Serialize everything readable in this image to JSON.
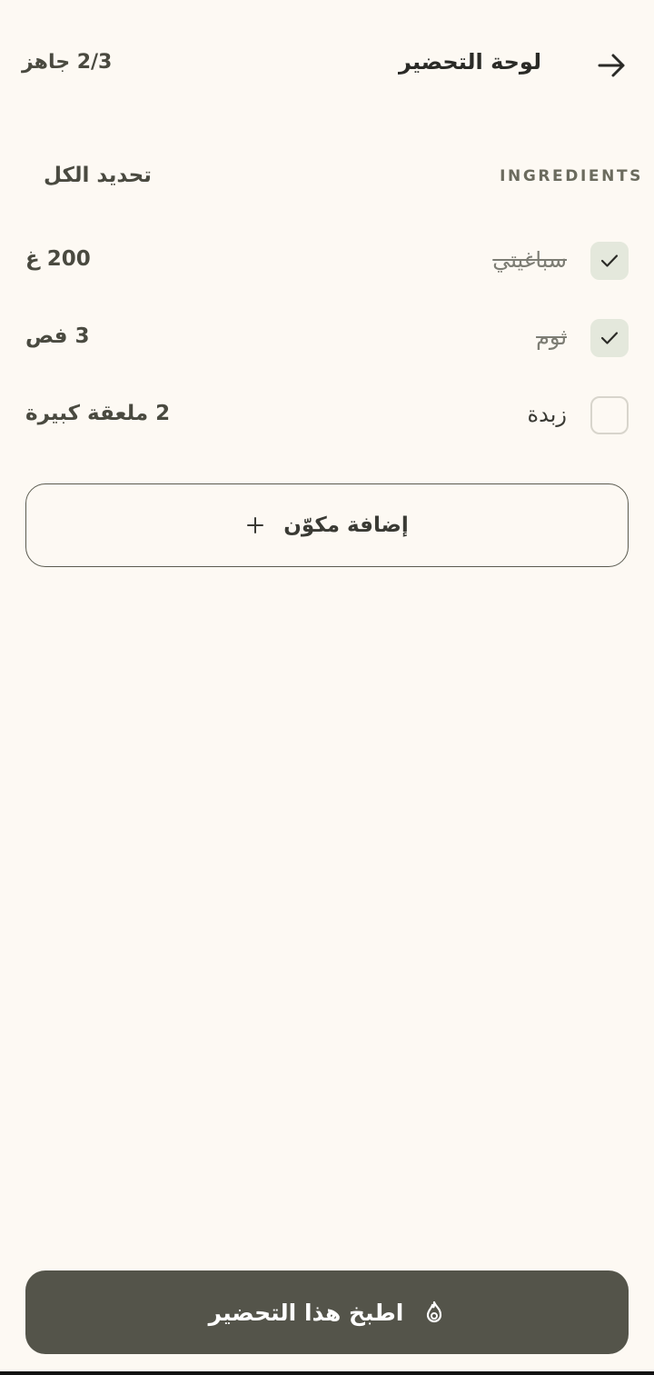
{
  "header": {
    "title": "لوحة التحضير",
    "ready_count": "2/3 جاهز"
  },
  "section": {
    "label": "INGREDIENTS",
    "select_all": "تحديد الكل"
  },
  "ingredients": [
    {
      "name": "سباغيتي",
      "qty": "200 غ",
      "checked": true
    },
    {
      "name": "ثوم",
      "qty": "3 فص",
      "checked": true
    },
    {
      "name": "زبدة",
      "qty": "2 ملعقة كبيرة",
      "checked": false
    }
  ],
  "add_button": {
    "label": "إضافة مكوّن"
  },
  "cook_button": {
    "label": "اطبخ هذا التحضير"
  },
  "icons": {
    "back": "arrow-right-icon",
    "check": "check-icon",
    "add": "plus-icon",
    "cook": "flame-icon"
  },
  "colors": {
    "background": "#fdf9f3",
    "primary_button": "#54544a",
    "checked_box": "#e4e8dc",
    "text": "#2f2f2a"
  }
}
